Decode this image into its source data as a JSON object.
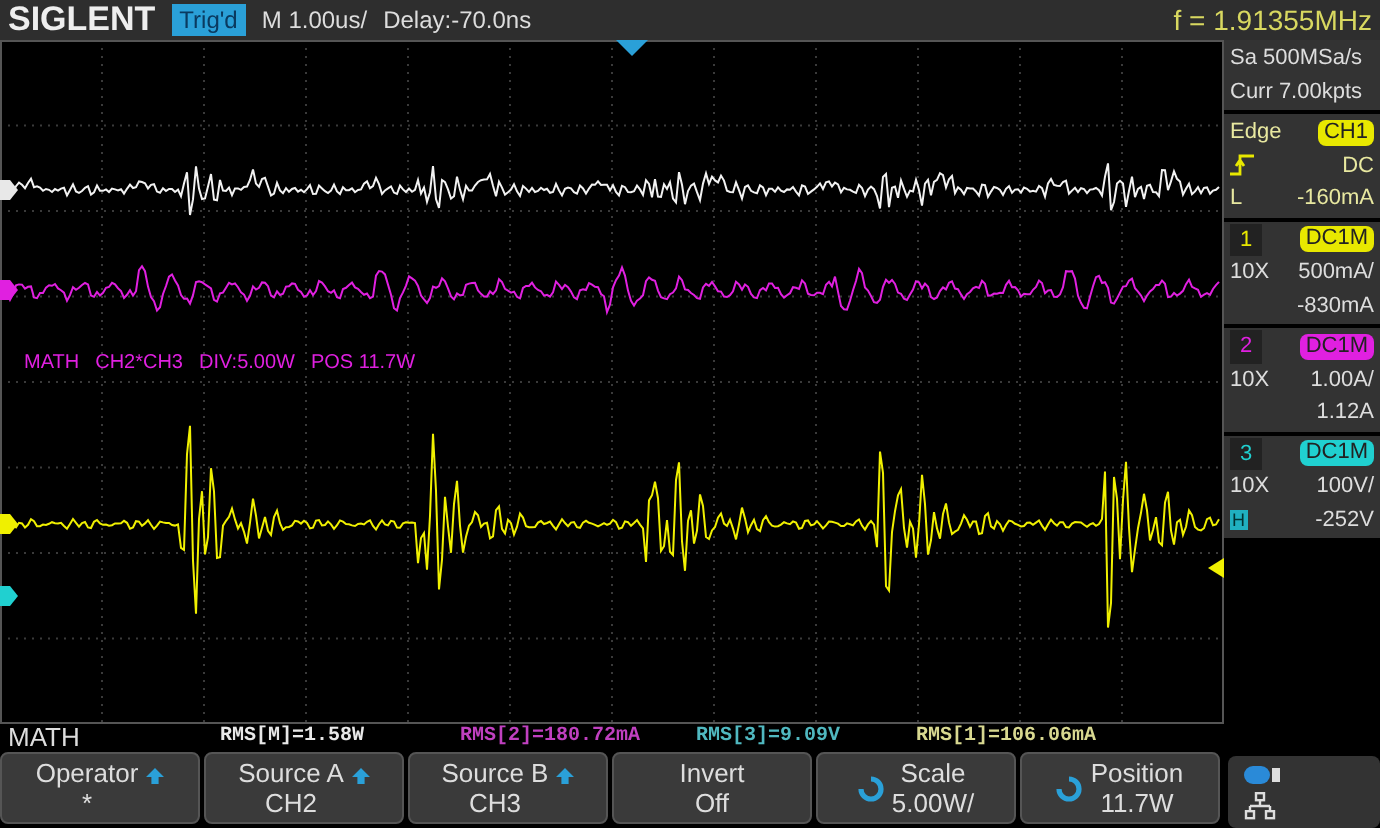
{
  "header": {
    "brand": "SIGLENT",
    "trigger_status": "Trig'd",
    "timebase": "M 1.00us/",
    "delay": "Delay:-70.0ns",
    "frequency": "f = 1.91355MHz"
  },
  "acquisition": {
    "sample_rate": "Sa 500MSa/s",
    "memory": "Curr 7.00kpts"
  },
  "trigger": {
    "type": "Edge",
    "source": "CH1",
    "coupling": "DC",
    "threshold_label": "L",
    "threshold": "-160mA"
  },
  "math_overlay": {
    "label": "MATH",
    "expression": "CH2*CH3",
    "division": "DIV:5.00W",
    "position": "POS 11.7W"
  },
  "traces": [
    {
      "color": "#f2f2f2",
      "kind": "spiky"
    },
    {
      "color": "#e020e0",
      "kind": "ringing"
    },
    {
      "color": "#f0f000",
      "kind": "burst"
    }
  ],
  "channels": [
    {
      "number": "1",
      "coupling": "DC1M",
      "probe": "10X",
      "scale": "500mA/",
      "offset": "-830mA",
      "color": "#e8e800"
    },
    {
      "number": "2",
      "coupling": "DC1M",
      "probe": "10X",
      "scale": "1.00A/",
      "offset": "1.12A",
      "color": "#e020e0"
    },
    {
      "number": "3",
      "coupling": "DC1M",
      "probe": "10X",
      "scale": "100V/",
      "offset": "-252V",
      "color": "#20d0d0",
      "badge": "H"
    }
  ],
  "menu_title": "MATH",
  "measurements": [
    {
      "text": "RMS[M]=1.58W",
      "color": "#e8e8e8"
    },
    {
      "text": "RMS[2]=180.72mA",
      "color": "#c040c0"
    },
    {
      "text": "RMS[3]=9.09V",
      "color": "#50b8c0"
    },
    {
      "text": "RMS[1]=106.06mA",
      "color": "#d8d890"
    }
  ],
  "softkeys": [
    {
      "label": "Operator",
      "value": "*",
      "kind": "menu"
    },
    {
      "label": "Source A",
      "value": "CH2",
      "kind": "menu"
    },
    {
      "label": "Source B",
      "value": "CH3",
      "kind": "menu"
    },
    {
      "label": "Invert",
      "value": "Off",
      "kind": "plain"
    },
    {
      "label": "Scale",
      "value": "5.00W/",
      "kind": "knob"
    },
    {
      "label": "Position",
      "value": "11.7W",
      "kind": "knob"
    }
  ]
}
